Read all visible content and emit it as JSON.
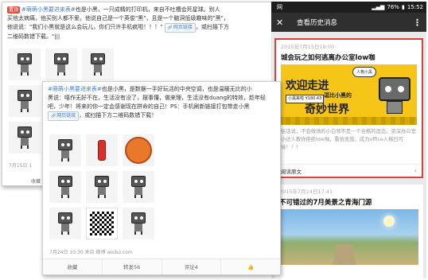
{
  "back_card": {
    "line1_tag": "#萌萌小黑要进来表#",
    "line1_text": "也是小黑，一只成精的打印机，来自不吐槽会死星球。别人",
    "line2_text": "买他太病痛，他买别人都不爱。他说自己是一个英俊\"黑\"，且是一个脑洞低级趣味的\"黑\"，",
    "line3_text": "他说说：\"我们小黑就是这么会玩儿，你们只许手机疯啦！！！\"",
    "link_label": "网页链接",
    "line3_suffix": "，或扫描下方",
    "line4_text": "二维码数错下载。\"|||",
    "badge_label": "置顶",
    "meta": "7月15日 1",
    "action_label": "收藏"
  },
  "front_card": {
    "line1_tag": "#萌萌小黑要进来表#",
    "line1_text": "也是小黑，是数据一手好玩活的中央空调，也是温暖无比的小",
    "line2_text": "黑说：嘻作无好不在，生活没有没了，摆事懂，做来理，生活没有duang的特效，趁年轻",
    "line3_text": "吧，少年！将来的你一定会感谢现在拼命的自己！PS：手机刷新链接打包带走小黑",
    "link_label": "网页链接",
    "line4_text": "，或扫描下方二维码数错下载！",
    "meta": "7月24日 10:30 来自 微博 weibo.com",
    "actions": [
      "收藏",
      "转发56",
      "评论4",
      "👍"
    ]
  },
  "phone": {
    "status": {
      "carrier": "网",
      "battery": "76%",
      "time": "15:52"
    },
    "title": "查看历史消息",
    "close_icon": "close-icon",
    "more_icon": "more-icon",
    "articles": [
      {
        "date": "2015年7月15日19:00",
        "title": "城会玩之如何逃离办公室low咖",
        "cover": {
          "bubble": "人格小黑",
          "line1": "欢迎走进",
          "line2": "逗比小黑的",
          "line3": "奇妙世界",
          "badge": "小黑来啦 ¥180.43"
        },
        "desc": "俗话说，不会做场的小白领不是一个合格的逗比。资深办公室小达人教你拒绝low咖，重拾无敌，成为office人格日可待！！！",
        "footer": "阅读原文"
      },
      {
        "date": "2015年7月14日17:41",
        "title": "不可错过的7月美景之青海门源"
      }
    ]
  }
}
